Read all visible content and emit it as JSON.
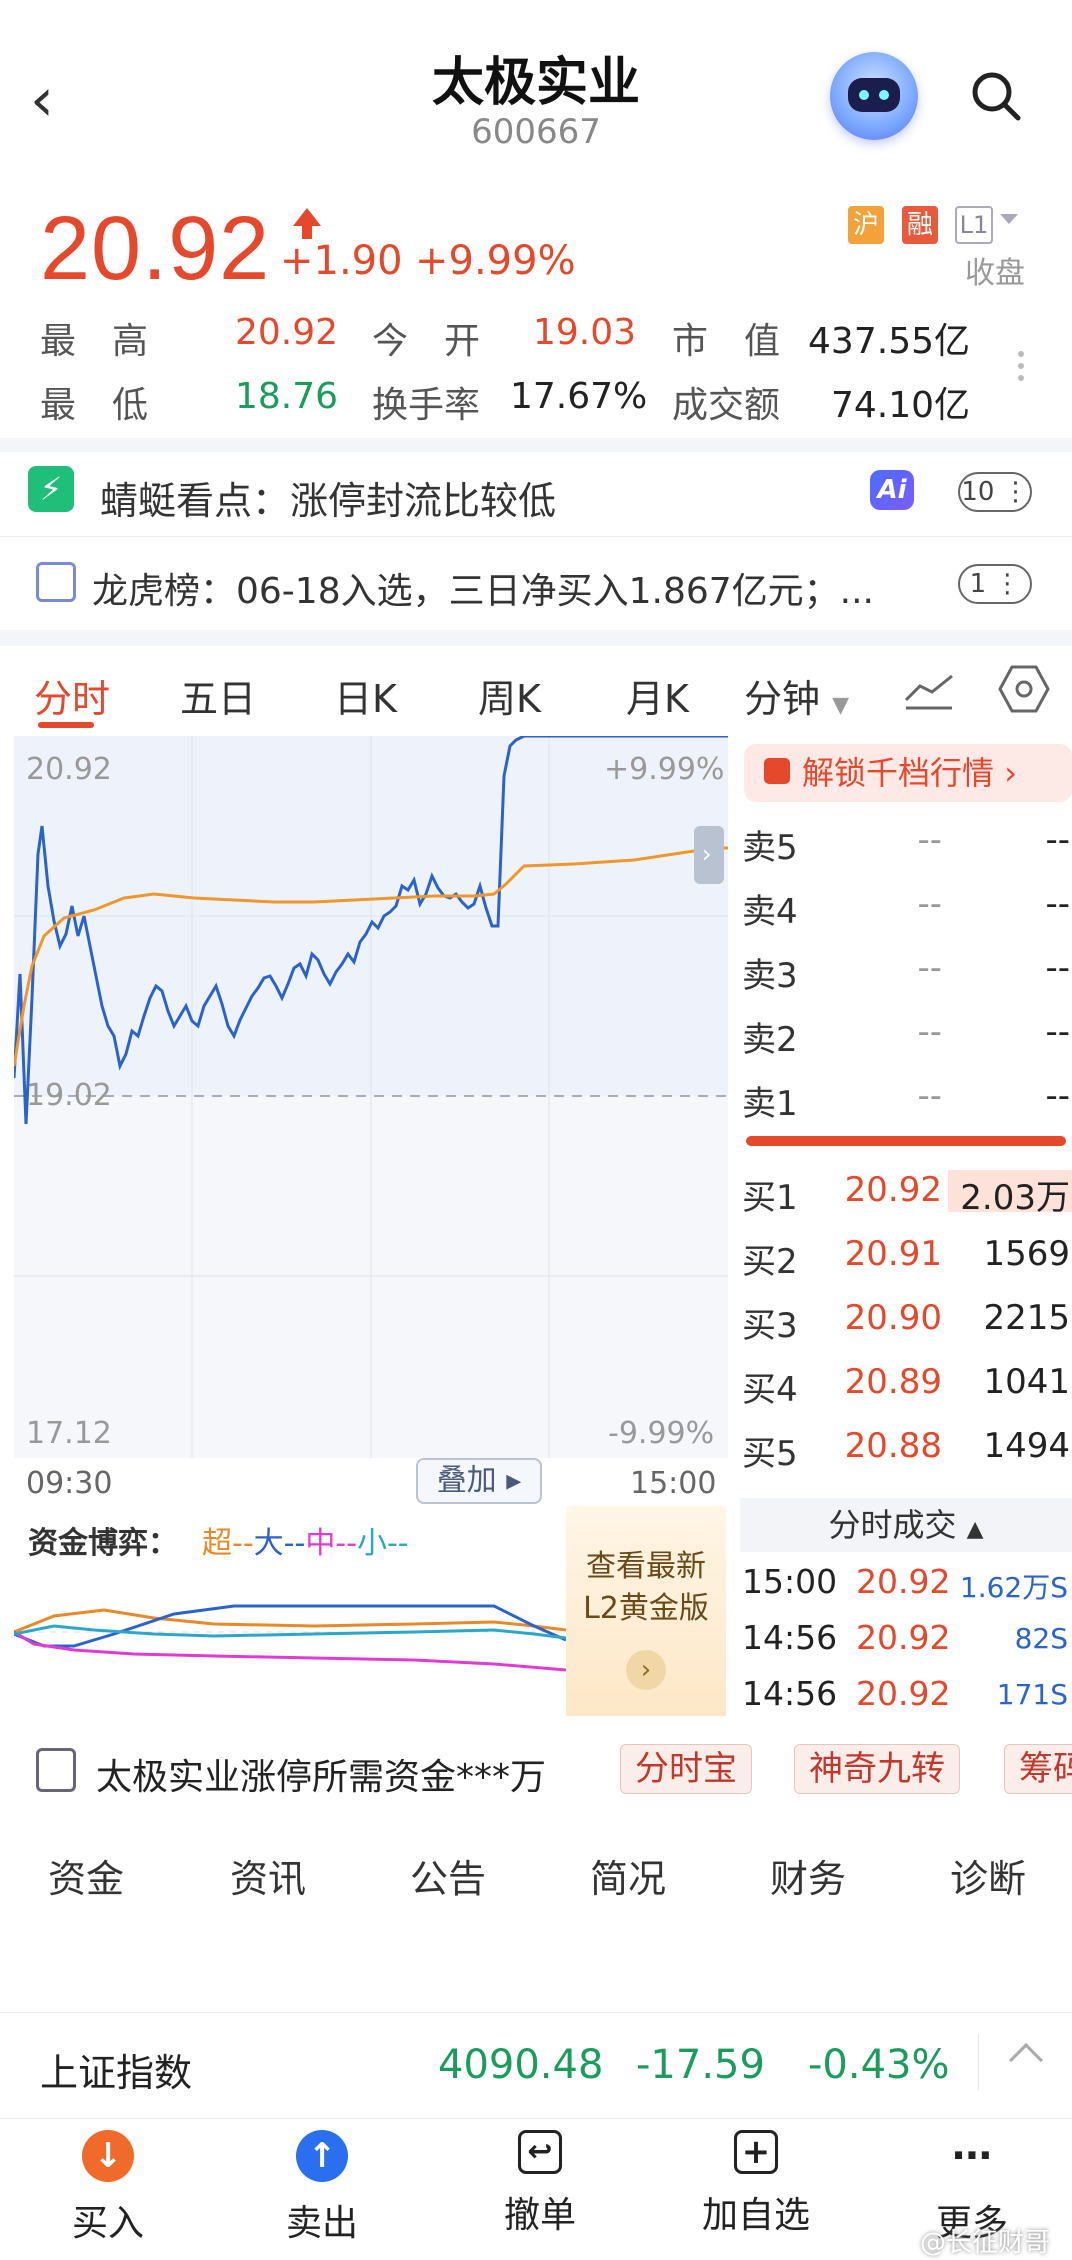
{
  "header": {
    "title": "太极实业",
    "code": "600667"
  },
  "quote": {
    "price": "20.92",
    "change": "+1.90",
    "change_pct": "+9.99%",
    "status": "收盘",
    "tags": {
      "hu": "沪",
      "rong": "融",
      "level": "L1"
    },
    "high_label": "最　高",
    "high": "20.92",
    "open_label": "今　开",
    "open": "19.03",
    "mcap_label": "市　值",
    "mcap": "437.55亿",
    "low_label": "最　低",
    "low": "18.76",
    "turnover_label": "换手率",
    "turnover": "17.67%",
    "amount_label": "成交额",
    "amount": "74.10亿"
  },
  "insight": {
    "text": "蜻蜓看点：涨停封流比较低",
    "count": "10"
  },
  "lhb": {
    "text": "龙虎榜：06-18入选，三日净买入1.867亿元；...",
    "count": "1"
  },
  "tabs": [
    "分时",
    "五日",
    "日K",
    "周K",
    "月K",
    "分钟"
  ],
  "chart": {
    "top_price": "20.92",
    "top_pct": "+9.99%",
    "mid_price": "19.02",
    "bottom_price": "17.12",
    "bottom_pct": "-9.99%",
    "t_start": "09:30",
    "t_end": "15:00",
    "overlay": "叠加"
  },
  "fund": {
    "title": "资金博弈：",
    "legend": {
      "super": "超--",
      "big": "大--",
      "mid": "中--",
      "small": "小--"
    },
    "l2_line1": "查看最新",
    "l2_line2": "L2黄金版",
    "colors": {
      "super": "#e8892a",
      "big": "#2a63c9",
      "mid": "#e23bd3",
      "small": "#2aa7c9"
    }
  },
  "orderbook": {
    "unlock": "解锁千档行情",
    "asks": [
      {
        "label": "卖5",
        "price": "--",
        "vol": "--"
      },
      {
        "label": "卖4",
        "price": "--",
        "vol": "--"
      },
      {
        "label": "卖3",
        "price": "--",
        "vol": "--"
      },
      {
        "label": "卖2",
        "price": "--",
        "vol": "--"
      },
      {
        "label": "卖1",
        "price": "--",
        "vol": "--"
      }
    ],
    "bids": [
      {
        "label": "买1",
        "price": "20.92",
        "vol": "2.03万"
      },
      {
        "label": "买2",
        "price": "20.91",
        "vol": "1569"
      },
      {
        "label": "买3",
        "price": "20.90",
        "vol": "2215"
      },
      {
        "label": "买4",
        "price": "20.89",
        "vol": "1041"
      },
      {
        "label": "买5",
        "price": "20.88",
        "vol": "1494"
      }
    ]
  },
  "ticks": {
    "header": "分时成交",
    "rows": [
      {
        "time": "15:00",
        "price": "20.92",
        "vol": "1.62万S"
      },
      {
        "time": "14:56",
        "price": "20.92",
        "vol": "82S"
      },
      {
        "time": "14:56",
        "price": "20.92",
        "vol": "171S"
      }
    ]
  },
  "promo": {
    "text": "太极实业涨停所需资金***万",
    "chips": [
      "分时宝",
      "神奇九转",
      "筹码"
    ]
  },
  "subtabs": [
    "资金",
    "资讯",
    "公告",
    "简况",
    "财务",
    "诊断"
  ],
  "index": {
    "name": "上证指数",
    "value": "4090.48",
    "change": "-17.59",
    "pct": "-0.43%"
  },
  "bottom": [
    {
      "label": "买入",
      "icon": "↓",
      "color": "#f06a2b"
    },
    {
      "label": "卖出",
      "icon": "↑",
      "color": "#2a6ff0"
    },
    {
      "label": "撤单",
      "icon": "↩",
      "color": "#fff"
    },
    {
      "label": "加自选",
      "icon": "+",
      "color": "#fff"
    },
    {
      "label": "更多",
      "icon": "⋯",
      "color": "#fff"
    }
  ],
  "watermark": "@长征财哥"
}
